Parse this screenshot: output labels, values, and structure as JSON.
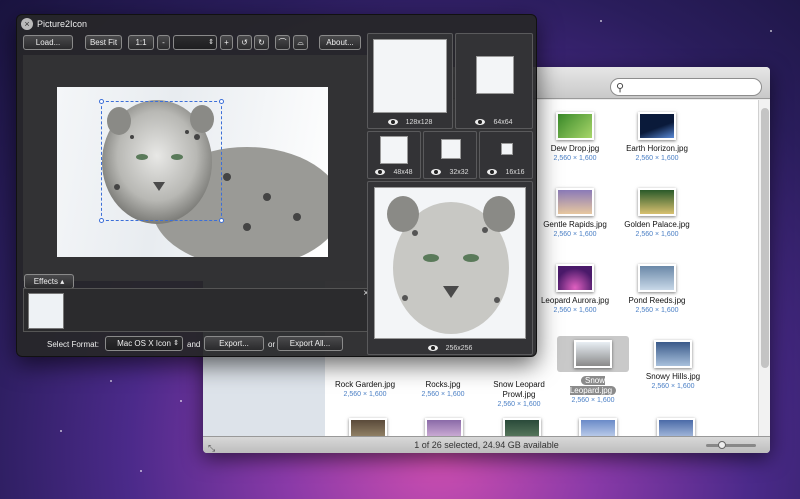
{
  "finder": {
    "status_text": "1 of 26 selected, 24.94 GB available",
    "items": [
      {
        "name": "Dew Drop.jpg",
        "size": "2,560 × 1,600",
        "c1": "#3a8a2a",
        "c2": "#a8d66a"
      },
      {
        "name": "Earth Horizon.jpg",
        "size": "2,560 × 1,600",
        "c1": "#0a1a3a",
        "c2": "#5a8ad8"
      },
      {
        "name": "Gentle Rapids.jpg",
        "size": "2,560 × 1,600",
        "c1": "#8a7ab8",
        "c2": "#e8c8a0"
      },
      {
        "name": "Golden Palace.jpg",
        "size": "2,560 × 1,600",
        "c1": "#2a5a2a",
        "c2": "#d8c070"
      },
      {
        "name": "Leopard Aurora.jpg",
        "size": "2,560 × 1,600",
        "c1": "#4a1a6a",
        "c2": "#e060c0"
      },
      {
        "name": "Pond Reeds.jpg",
        "size": "2,560 × 1,600",
        "c1": "#6a88a8",
        "c2": "#c8d8e8"
      },
      {
        "name": "Rock Garden.jpg",
        "size": "2,560 × 1,600",
        "c1": "#3a3a2a",
        "c2": "#8a8a6a"
      },
      {
        "name": "Rocks.jpg",
        "size": "2,560 × 1,600",
        "c1": "#4a4a4a",
        "c2": "#9a9a8a"
      },
      {
        "name": "Snow Leopard Prowl.jpg",
        "size": "2,560 × 1,600",
        "c1": "#5a5a5a",
        "c2": "#cacaca"
      },
      {
        "name": "Snow Leopard.jpg",
        "size": "2,560 × 1,600",
        "c1": "#8a8a8a",
        "c2": "#e8eef4"
      },
      {
        "name": "Snowy Hills.jpg",
        "size": "2,560 × 1,600",
        "c1": "#3a5a8a",
        "c2": "#a8c0dc"
      }
    ]
  },
  "app": {
    "title": "Picture2Icon",
    "load_label": "Load...",
    "bestfit_label": "Best Fit",
    "ratio_label": "1:1",
    "minus_label": "-",
    "plus_label": "+",
    "about_label": "About...",
    "effects_label": "Effects",
    "close_effects": "×",
    "select_format_label": "Select Format:",
    "format_value": "Mac OS X Icon",
    "and_label": "and",
    "export_label": "Export...",
    "or_label": "or",
    "export_all_label": "Export All..."
  },
  "previews": [
    {
      "size_label": "128x128"
    },
    {
      "size_label": "64x64"
    },
    {
      "size_label": "48x48"
    },
    {
      "size_label": "32x32"
    },
    {
      "size_label": "16x16"
    },
    {
      "size_label": "256x256"
    }
  ],
  "colors": {
    "selection": "#3c6fd8",
    "file_size_text": "#4a7fc5"
  }
}
